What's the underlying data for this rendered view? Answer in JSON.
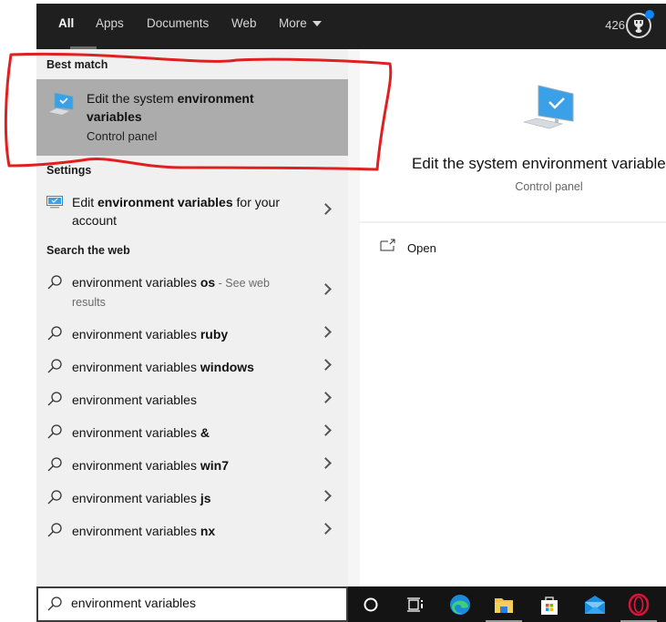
{
  "top_bar": {
    "tabs": [
      {
        "label": "All",
        "active": true
      },
      {
        "label": "Apps"
      },
      {
        "label": "Documents"
      },
      {
        "label": "Web"
      },
      {
        "label": "More"
      }
    ],
    "reward_points": "426",
    "reward_icon": "trophy-icon"
  },
  "results": {
    "best_match_header": "Best match",
    "best_match": {
      "title_plain": "Edit the system ",
      "title_bold": "environment variables",
      "subtitle": "Control panel",
      "icon": "computer-check-icon"
    },
    "settings_header": "Settings",
    "settings_items": [
      {
        "pre": "Edit ",
        "bold": "environment variables",
        "post": " for your account",
        "icon": "monitor-settings-icon"
      }
    ],
    "web_header": "Search the web",
    "web_items": [
      {
        "plain": "environment variables ",
        "bold": "os",
        "suffix": " - See web results"
      },
      {
        "plain": "environment variables ",
        "bold": "ruby"
      },
      {
        "plain": "environment variables ",
        "bold": "windows"
      },
      {
        "plain": "environment variables",
        "bold": ""
      },
      {
        "plain": "environment variables ",
        "bold": "&"
      },
      {
        "plain": "environment variables ",
        "bold": "win7"
      },
      {
        "plain": "environment variables ",
        "bold": "js"
      },
      {
        "plain": "environment variables ",
        "bold": "nx"
      }
    ]
  },
  "preview": {
    "title": "Edit the system environment variables",
    "subtitle": "Control panel",
    "actions": [
      {
        "label": "Open",
        "icon": "open-window-icon"
      }
    ]
  },
  "search": {
    "value": "environment variables",
    "icon": "search-icon"
  },
  "taskbar": {
    "items": [
      "cortana-icon",
      "task-view-icon",
      "edge-icon",
      "file-explorer-icon",
      "microsoft-store-icon",
      "mail-icon",
      "opera-icon"
    ]
  },
  "colors": {
    "top_bar": "#1f1f1f",
    "selected_row": "#acacac",
    "annotation_red": "#e02020",
    "reward_dot": "#0a84ff"
  }
}
